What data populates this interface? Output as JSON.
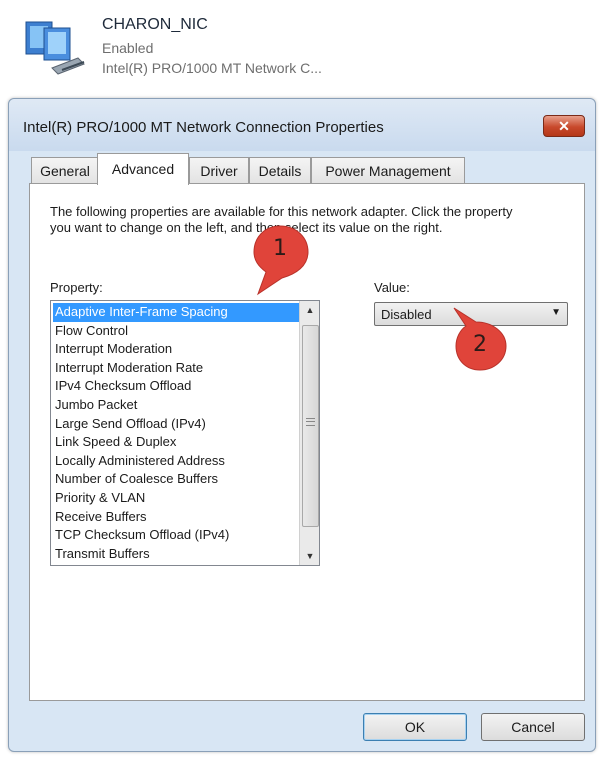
{
  "adapter": {
    "name": "CHARON_NIC",
    "status": "Enabled",
    "device": "Intel(R) PRO/1000 MT Network C..."
  },
  "dialog": {
    "title": "Intel(R) PRO/1000 MT Network Connection Properties",
    "close_label": "✕",
    "tabs": [
      {
        "label": "General"
      },
      {
        "label": "Advanced"
      },
      {
        "label": "Driver"
      },
      {
        "label": "Details"
      },
      {
        "label": "Power Management"
      }
    ],
    "active_tab": "Advanced",
    "description": "The following properties are available for this network adapter. Click the property you want to change on the left, and then select its value on the right.",
    "property_label": "Property:",
    "value_label": "Value:",
    "properties": [
      "Adaptive Inter-Frame Spacing",
      "Flow Control",
      "Interrupt Moderation",
      "Interrupt Moderation Rate",
      "IPv4 Checksum Offload",
      "Jumbo Packet",
      "Large Send Offload (IPv4)",
      "Link Speed & Duplex",
      "Locally Administered Address",
      "Number of Coalesce Buffers",
      "Priority & VLAN",
      "Receive Buffers",
      "TCP Checksum Offload (IPv4)",
      "Transmit Buffers"
    ],
    "selected_property": "Adaptive Inter-Frame Spacing",
    "value_selected": "Disabled",
    "ok_label": "OK",
    "cancel_label": "Cancel"
  },
  "annotations": [
    {
      "number": "1"
    },
    {
      "number": "2"
    }
  ],
  "colors": {
    "selection": "#3399ff",
    "marker": "#e0443a",
    "close_button": "#c8492c",
    "dialog_frame": "#d8e6f4"
  }
}
